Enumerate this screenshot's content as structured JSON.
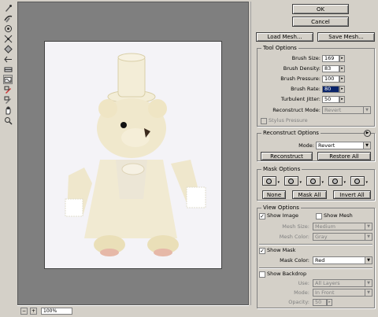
{
  "dialog": {
    "ok_label": "OK",
    "cancel_label": "Cancel",
    "load_mesh_label": "Load Mesh...",
    "save_mesh_label": "Save Mesh..."
  },
  "tools": [
    {
      "name": "forward-warp-icon"
    },
    {
      "name": "reconstruct-tool-icon"
    },
    {
      "name": "twirl-clockwise-icon"
    },
    {
      "name": "pucker-icon"
    },
    {
      "name": "bloat-icon"
    },
    {
      "name": "push-left-icon"
    },
    {
      "name": "mirror-icon"
    },
    {
      "name": "turbulence-icon"
    },
    {
      "name": "freeze-mask-icon"
    },
    {
      "name": "thaw-mask-icon"
    },
    {
      "name": "hand-icon"
    },
    {
      "name": "zoom-icon"
    }
  ],
  "status": {
    "zoom": "100%"
  },
  "tool_options": {
    "title": "Tool Options",
    "brush_size_label": "Brush Size:",
    "brush_size": "169",
    "brush_density_label": "Brush Density:",
    "brush_density": "83",
    "brush_pressure_label": "Brush Pressure:",
    "brush_pressure": "100",
    "brush_rate_label": "Brush Rate:",
    "brush_rate": "80",
    "turbulent_jitter_label": "Turbulent Jitter:",
    "turbulent_jitter": "50",
    "reconstruct_mode_label": "Reconstruct Mode:",
    "reconstruct_mode": "Revert",
    "stylus_pressure_label": "Stylus Pressure"
  },
  "reconstruct_options": {
    "title": "Reconstruct Options",
    "mode_label": "Mode:",
    "mode": "Revert",
    "reconstruct_label": "Reconstruct",
    "restore_all_label": "Restore All"
  },
  "mask_options": {
    "title": "Mask Options",
    "none_label": "None",
    "mask_all_label": "Mask All",
    "invert_all_label": "Invert All"
  },
  "view_options": {
    "title": "View Options",
    "show_image_label": "Show Image",
    "show_image": true,
    "show_mesh_label": "Show Mesh",
    "show_mesh": false,
    "mesh_size_label": "Mesh Size:",
    "mesh_size": "Medium",
    "mesh_color_label": "Mesh Color:",
    "mesh_color": "Gray",
    "show_mask_label": "Show Mask",
    "show_mask": true,
    "mask_color_label": "Mask Color:",
    "mask_color": "Red",
    "show_backdrop_label": "Show Backdrop",
    "show_backdrop": false,
    "use_label": "Use:",
    "use": "All Layers",
    "mode_label": "Mode:",
    "mode": "In Front",
    "opacity_label": "Opacity:",
    "opacity": "50"
  }
}
